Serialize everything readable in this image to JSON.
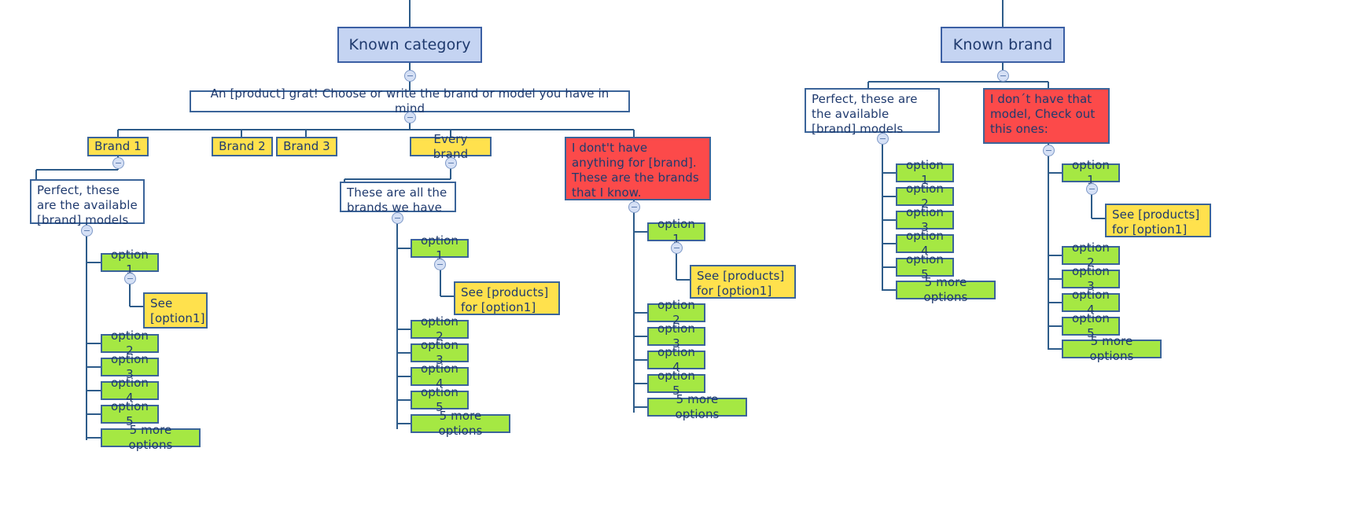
{
  "diagram": {
    "title_nodes": {
      "known_category": "Known category",
      "known_brand": "Known brand"
    },
    "prompt": "An [product] grat! Choose or write the brand or model you have in mind",
    "colors": {
      "blue_node": "#c5d4f2",
      "yellow_node": "#ffe14d",
      "green_node": "#a5e843",
      "red_node": "#fc4a4a",
      "white_node": "#ffffff",
      "line": "#2e5c8a",
      "text": "#1f3a6e"
    },
    "nodes": {
      "brand1": "Brand 1",
      "brand2": "Brand 2",
      "brand3": "Brand 3",
      "every_brand": "Every brand",
      "no_brand_red": "I dont't have\nanything for [brand].\nThese are the brands\nthat I know.",
      "perfect_left": "Perfect, these\nare the available\n[brand] models",
      "all_brands": "These are all the\nbrands we have",
      "see_option1_short": "See\n[option1]",
      "see_products_option1": "See [products]\nfor [option1]",
      "perfect_right": "Perfect, these are\nthe available\n[brand] models",
      "no_model_red": "I don´t have that\nmodel, Check out\nthis ones:",
      "option1": "option 1",
      "option2": "option 2",
      "option3": "option 3",
      "option4": "option 4",
      "option5": "option 5",
      "more_options": "5 more options"
    },
    "branches": {
      "left_brand_options": [
        "option 1",
        "option 2",
        "option 3",
        "option 4",
        "option 5",
        "5 more options"
      ],
      "every_brand_options": [
        "option 1",
        "option 2",
        "option 3",
        "option 4",
        "option 5",
        "5 more options"
      ],
      "no_brand_options": [
        "option 1",
        "option 2",
        "option 3",
        "option 4",
        "option 5",
        "5 more options"
      ],
      "known_brand_perfect_options": [
        "option 1",
        "option 2",
        "option 3",
        "option 4",
        "option 5",
        "5 more options"
      ],
      "known_brand_red_options": [
        "option 1",
        "option 2",
        "option 3",
        "option 4",
        "option 5",
        "5 more options"
      ]
    }
  }
}
